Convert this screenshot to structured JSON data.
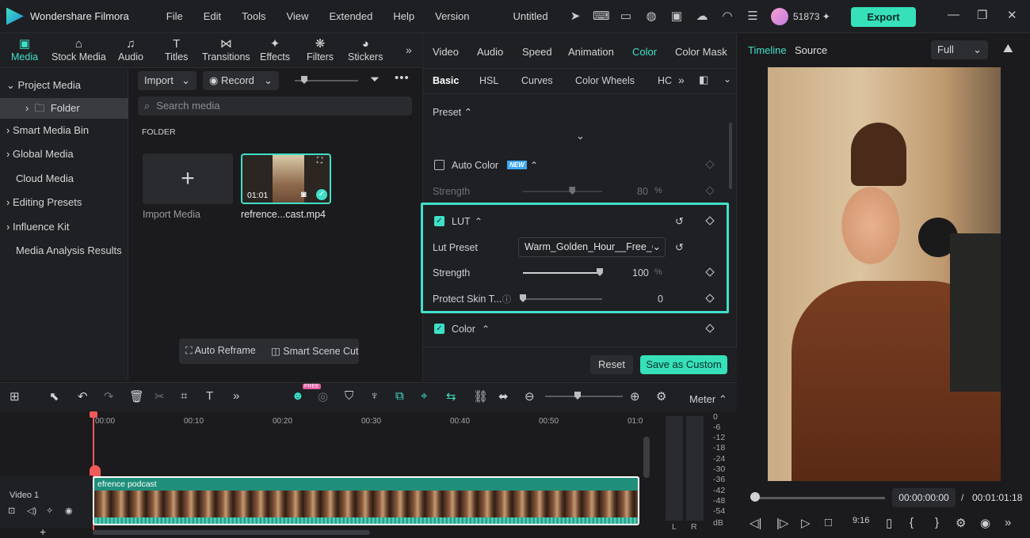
{
  "app": {
    "name": "Wondershare Filmora",
    "doc_title": "Untitled",
    "credits": "51873",
    "export_label": "Export"
  },
  "menu": [
    "File",
    "Edit",
    "Tools",
    "View",
    "Extended",
    "Help",
    "Version"
  ],
  "media_tabs": [
    "Media",
    "Stock Media",
    "Audio",
    "Titles",
    "Transitions",
    "Effects",
    "Filters",
    "Stickers"
  ],
  "sidebar": {
    "items": [
      "Project Media",
      "Folder",
      "Smart Media Bin",
      "Global Media",
      "Cloud Media",
      "Editing Presets",
      "Influence Kit",
      "Media Analysis Results"
    ]
  },
  "media": {
    "import_label": "Import",
    "record_label": "Record",
    "search_placeholder": "Search media",
    "folder_heading": "FOLDER",
    "import_media_label": "Import Media",
    "clip_name": "refrence...cast.mp4",
    "clip_duration": "01:01",
    "auto_reframe": "Auto Reframe",
    "smart_scene_cut": "Smart Scene Cut"
  },
  "inspector": {
    "tabs": [
      "Video",
      "Audio",
      "Speed",
      "Animation",
      "Color",
      "Color Mask"
    ],
    "active_tab": "Color",
    "subtabs": [
      "Basic",
      "HSL",
      "Curves",
      "Color Wheels",
      "HC"
    ],
    "preset_label": "Preset",
    "auto_color_label": "Auto Color",
    "new_badge": "NEW",
    "auto_strength_label": "Strength",
    "auto_strength_value": "80",
    "auto_strength_unit": "%",
    "auto_strength_level": 0.8,
    "lut_label": "LUT",
    "lut_preset_label": "Lut Preset",
    "lut_preset_value": "Warm_Golden_Hour__Free_Ci",
    "lut_strength_label": "Strength",
    "lut_strength_value": "100",
    "lut_strength_unit": "%",
    "lut_strength_level": 1.0,
    "protect_skin_label": "Protect Skin T...",
    "protect_skin_value": "0",
    "protect_skin_level": 0,
    "color_label": "Color",
    "reset_label": "Reset",
    "save_custom_label": "Save as Custom"
  },
  "preview": {
    "timeline_tab": "Timeline",
    "source_tab": "Source",
    "quality": "Full",
    "current_time": "00:00:00:00",
    "total_time": "00:01:01:18",
    "separator": "/"
  },
  "timeline": {
    "meter_label": "Meter",
    "ruler": [
      "00:00",
      "00:10",
      "00:20",
      "00:30",
      "00:40",
      "00:50",
      "01:0"
    ],
    "track_label": "Video 1",
    "clip_label": "efrence podcast",
    "db_scale": [
      "0",
      "-6",
      "-12",
      "-18",
      "-24",
      "-30",
      "-36",
      "-42",
      "-48",
      "-54",
      "dB"
    ],
    "lr": [
      "L",
      "R"
    ],
    "free_badge": "FREE"
  },
  "colors": {
    "accent": "#3fe0c8",
    "export_bg": "#36e0b9",
    "playhead": "#f05a5a",
    "clip_bg": "#1f8f7b"
  }
}
